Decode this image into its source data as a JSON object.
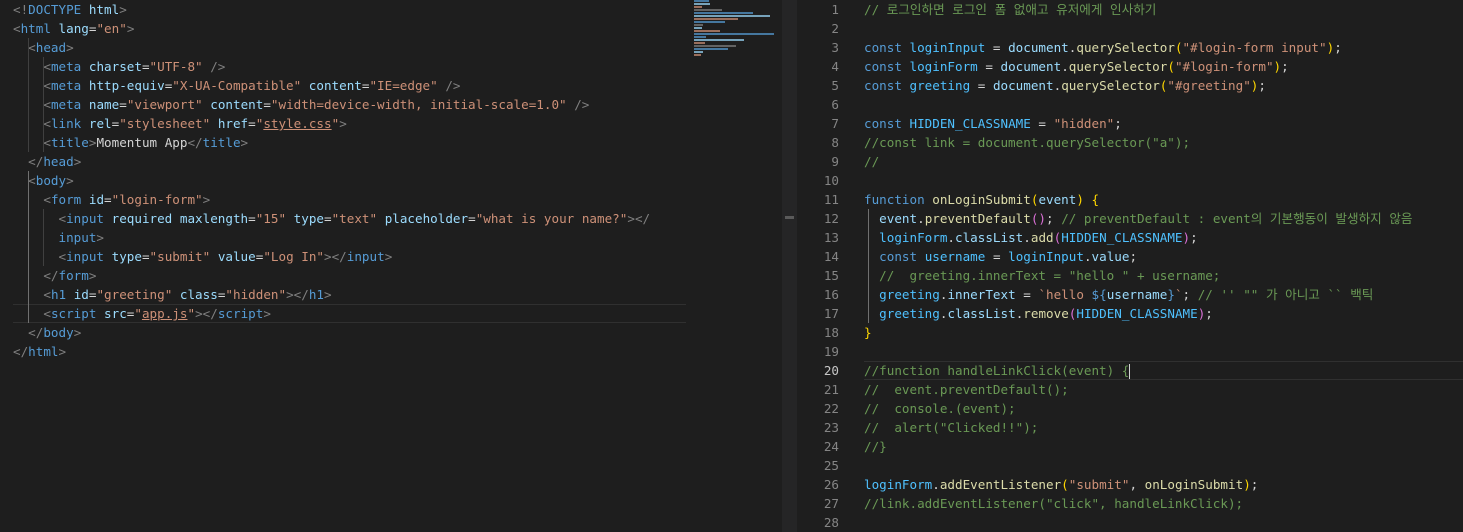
{
  "left_editor": {
    "lines": [
      [
        [
          "t-br",
          "<!"
        ],
        [
          "t-tag",
          "DOCTYPE"
        ],
        [
          "t-p",
          " "
        ],
        [
          "t-attr",
          "html"
        ],
        [
          "t-br",
          ">"
        ]
      ],
      [
        [
          "t-br",
          "<"
        ],
        [
          "t-tag",
          "html"
        ],
        [
          "t-p",
          " "
        ],
        [
          "t-attr",
          "lang"
        ],
        [
          "t-p",
          "="
        ],
        [
          "t-str",
          "\"en\""
        ],
        [
          "t-br",
          ">"
        ]
      ],
      [
        [
          "t-p",
          "  "
        ],
        [
          "t-br",
          "<"
        ],
        [
          "t-tag",
          "head"
        ],
        [
          "t-br",
          ">"
        ]
      ],
      [
        [
          "t-p",
          "    "
        ],
        [
          "t-br",
          "<"
        ],
        [
          "t-tag",
          "meta"
        ],
        [
          "t-p",
          " "
        ],
        [
          "t-attr",
          "charset"
        ],
        [
          "t-p",
          "="
        ],
        [
          "t-str",
          "\"UTF-8\""
        ],
        [
          "t-p",
          " "
        ],
        [
          "t-br",
          "/>"
        ]
      ],
      [
        [
          "t-p",
          "    "
        ],
        [
          "t-br",
          "<"
        ],
        [
          "t-tag",
          "meta"
        ],
        [
          "t-p",
          " "
        ],
        [
          "t-attr",
          "http-equiv"
        ],
        [
          "t-p",
          "="
        ],
        [
          "t-str",
          "\"X-UA-Compatible\""
        ],
        [
          "t-p",
          " "
        ],
        [
          "t-attr",
          "content"
        ],
        [
          "t-p",
          "="
        ],
        [
          "t-str",
          "\"IE=edge\""
        ],
        [
          "t-p",
          " "
        ],
        [
          "t-br",
          "/>"
        ]
      ],
      [
        [
          "t-p",
          "    "
        ],
        [
          "t-br",
          "<"
        ],
        [
          "t-tag",
          "meta"
        ],
        [
          "t-p",
          " "
        ],
        [
          "t-attr",
          "name"
        ],
        [
          "t-p",
          "="
        ],
        [
          "t-str",
          "\"viewport\""
        ],
        [
          "t-p",
          " "
        ],
        [
          "t-attr",
          "content"
        ],
        [
          "t-p",
          "="
        ],
        [
          "t-str",
          "\"width=device-width, initial-scale=1.0\""
        ],
        [
          "t-p",
          " "
        ],
        [
          "t-br",
          "/>"
        ]
      ],
      [
        [
          "t-p",
          "    "
        ],
        [
          "t-br",
          "<"
        ],
        [
          "t-tag",
          "link"
        ],
        [
          "t-p",
          " "
        ],
        [
          "t-attr",
          "rel"
        ],
        [
          "t-p",
          "="
        ],
        [
          "t-str",
          "\"stylesheet\""
        ],
        [
          "t-p",
          " "
        ],
        [
          "t-attr",
          "href"
        ],
        [
          "t-p",
          "="
        ],
        [
          "t-str",
          "\""
        ],
        [
          "t-link",
          "style.css"
        ],
        [
          "t-str",
          "\""
        ],
        [
          "t-br",
          ">"
        ]
      ],
      [
        [
          "t-p",
          "    "
        ],
        [
          "t-br",
          "<"
        ],
        [
          "t-tag",
          "title"
        ],
        [
          "t-br",
          ">"
        ],
        [
          "t-text",
          "Momentum App"
        ],
        [
          "t-br",
          "</"
        ],
        [
          "t-tag",
          "title"
        ],
        [
          "t-br",
          ">"
        ]
      ],
      [
        [
          "t-p",
          "  "
        ],
        [
          "t-br",
          "</"
        ],
        [
          "t-tag",
          "head"
        ],
        [
          "t-br",
          ">"
        ]
      ],
      [
        [
          "t-p",
          "  "
        ],
        [
          "t-br",
          "<"
        ],
        [
          "t-tag",
          "body"
        ],
        [
          "t-br",
          ">"
        ]
      ],
      [
        [
          "t-p",
          "    "
        ],
        [
          "t-br",
          "<"
        ],
        [
          "t-tag",
          "form"
        ],
        [
          "t-p",
          " "
        ],
        [
          "t-attr",
          "id"
        ],
        [
          "t-p",
          "="
        ],
        [
          "t-str",
          "\"login-form\""
        ],
        [
          "t-br",
          ">"
        ]
      ],
      [
        [
          "t-p",
          "      "
        ],
        [
          "t-br",
          "<"
        ],
        [
          "t-tag",
          "input"
        ],
        [
          "t-p",
          " "
        ],
        [
          "t-attr",
          "required"
        ],
        [
          "t-p",
          " "
        ],
        [
          "t-attr",
          "maxlength"
        ],
        [
          "t-p",
          "="
        ],
        [
          "t-str",
          "\"15\""
        ],
        [
          "t-p",
          " "
        ],
        [
          "t-attr",
          "type"
        ],
        [
          "t-p",
          "="
        ],
        [
          "t-str",
          "\"text\""
        ],
        [
          "t-p",
          " "
        ],
        [
          "t-attr",
          "placeholder"
        ],
        [
          "t-p",
          "="
        ],
        [
          "t-str",
          "\"what is your name?\""
        ],
        [
          "t-br",
          ">"
        ],
        [
          "t-br",
          "</"
        ]
      ],
      [
        [
          "t-p",
          "      "
        ],
        [
          "t-tag",
          "input"
        ],
        [
          "t-br",
          ">"
        ]
      ],
      [
        [
          "t-p",
          "      "
        ],
        [
          "t-br",
          "<"
        ],
        [
          "t-tag",
          "input"
        ],
        [
          "t-p",
          " "
        ],
        [
          "t-attr",
          "type"
        ],
        [
          "t-p",
          "="
        ],
        [
          "t-str",
          "\"submit\""
        ],
        [
          "t-p",
          " "
        ],
        [
          "t-attr",
          "value"
        ],
        [
          "t-p",
          "="
        ],
        [
          "t-str",
          "\"Log In\""
        ],
        [
          "t-br",
          ">"
        ],
        [
          "t-br",
          "</"
        ],
        [
          "t-tag",
          "input"
        ],
        [
          "t-br",
          ">"
        ]
      ],
      [
        [
          "t-p",
          "    "
        ],
        [
          "t-br",
          "</"
        ],
        [
          "t-tag",
          "form"
        ],
        [
          "t-br",
          ">"
        ]
      ],
      [
        [
          "t-p",
          "    "
        ],
        [
          "t-br",
          "<"
        ],
        [
          "t-tag",
          "h1"
        ],
        [
          "t-p",
          " "
        ],
        [
          "t-attr",
          "id"
        ],
        [
          "t-p",
          "="
        ],
        [
          "t-str",
          "\"greeting\""
        ],
        [
          "t-p",
          " "
        ],
        [
          "t-attr",
          "class"
        ],
        [
          "t-p",
          "="
        ],
        [
          "t-str",
          "\"hidden\""
        ],
        [
          "t-br",
          ">"
        ],
        [
          "t-br",
          "</"
        ],
        [
          "t-tag",
          "h1"
        ],
        [
          "t-br",
          ">"
        ]
      ],
      [
        [
          "t-p",
          "    "
        ],
        [
          "t-br",
          "<"
        ],
        [
          "t-tag",
          "script"
        ],
        [
          "t-p",
          " "
        ],
        [
          "t-attr",
          "src"
        ],
        [
          "t-p",
          "="
        ],
        [
          "t-str",
          "\""
        ],
        [
          "t-link",
          "app.js"
        ],
        [
          "t-str",
          "\""
        ],
        [
          "t-br",
          ">"
        ],
        [
          "t-br",
          "</"
        ],
        [
          "t-tag",
          "script"
        ],
        [
          "t-br",
          ">"
        ]
      ],
      [
        [
          "t-p",
          "  "
        ],
        [
          "t-br",
          "</"
        ],
        [
          "t-tag",
          "body"
        ],
        [
          "t-br",
          ">"
        ]
      ],
      [
        [
          "t-br",
          "</"
        ],
        [
          "t-tag",
          "html"
        ],
        [
          "t-br",
          ">"
        ]
      ]
    ]
  },
  "right_editor": {
    "current_line": 20,
    "line_numbers": [
      "1",
      "2",
      "3",
      "4",
      "5",
      "6",
      "7",
      "8",
      "9",
      "10",
      "11",
      "12",
      "13",
      "14",
      "15",
      "16",
      "17",
      "18",
      "19",
      "20",
      "21",
      "22",
      "23",
      "24",
      "25",
      "26",
      "27",
      "28"
    ],
    "lines": [
      [
        [
          "t-com",
          "// 로그인하면 로그인 폼 없애고 유저에게 인사하기"
        ]
      ],
      [],
      [
        [
          "t-kw",
          "const"
        ],
        [
          "t-p",
          " "
        ],
        [
          "t-const",
          "loginInput"
        ],
        [
          "t-p",
          " = "
        ],
        [
          "t-var",
          "document"
        ],
        [
          "t-p",
          "."
        ],
        [
          "t-fn",
          "querySelector"
        ],
        [
          "t-y",
          "("
        ],
        [
          "t-str",
          "\"#login-form input\""
        ],
        [
          "t-y",
          ")"
        ],
        [
          "t-p",
          ";"
        ]
      ],
      [
        [
          "t-kw",
          "const"
        ],
        [
          "t-p",
          " "
        ],
        [
          "t-const",
          "loginForm"
        ],
        [
          "t-p",
          " = "
        ],
        [
          "t-var",
          "document"
        ],
        [
          "t-p",
          "."
        ],
        [
          "t-fn",
          "querySelector"
        ],
        [
          "t-y",
          "("
        ],
        [
          "t-str",
          "\"#login-form\""
        ],
        [
          "t-y",
          ")"
        ],
        [
          "t-p",
          ";"
        ]
      ],
      [
        [
          "t-kw",
          "const"
        ],
        [
          "t-p",
          " "
        ],
        [
          "t-const",
          "greeting"
        ],
        [
          "t-p",
          " = "
        ],
        [
          "t-var",
          "document"
        ],
        [
          "t-p",
          "."
        ],
        [
          "t-fn",
          "querySelector"
        ],
        [
          "t-y",
          "("
        ],
        [
          "t-str",
          "\"#greeting\""
        ],
        [
          "t-y",
          ")"
        ],
        [
          "t-p",
          ";"
        ]
      ],
      [],
      [
        [
          "t-kw",
          "const"
        ],
        [
          "t-p",
          " "
        ],
        [
          "t-const",
          "HIDDEN_CLASSNAME"
        ],
        [
          "t-p",
          " = "
        ],
        [
          "t-str",
          "\"hidden\""
        ],
        [
          "t-p",
          ";"
        ]
      ],
      [
        [
          "t-com",
          "//const link = document.querySelector(\"a\");"
        ]
      ],
      [
        [
          "t-com",
          "//"
        ]
      ],
      [],
      [
        [
          "t-kw",
          "function"
        ],
        [
          "t-p",
          " "
        ],
        [
          "t-fn",
          "onLoginSubmit"
        ],
        [
          "t-y",
          "("
        ],
        [
          "t-var",
          "event"
        ],
        [
          "t-y",
          ")"
        ],
        [
          "t-p",
          " "
        ],
        [
          "t-y",
          "{"
        ]
      ],
      [
        [
          "t-p",
          "  "
        ],
        [
          "t-var",
          "event"
        ],
        [
          "t-p",
          "."
        ],
        [
          "t-fn",
          "preventDefault"
        ],
        [
          "t-m",
          "()"
        ],
        [
          "t-p",
          "; "
        ],
        [
          "t-com",
          "// preventDefault : event의 기본행동이 발생하지 않음"
        ]
      ],
      [
        [
          "t-p",
          "  "
        ],
        [
          "t-const",
          "loginForm"
        ],
        [
          "t-p",
          "."
        ],
        [
          "t-var",
          "classList"
        ],
        [
          "t-p",
          "."
        ],
        [
          "t-fn",
          "add"
        ],
        [
          "t-m",
          "("
        ],
        [
          "t-const",
          "HIDDEN_CLASSNAME"
        ],
        [
          "t-m",
          ")"
        ],
        [
          "t-p",
          ";"
        ]
      ],
      [
        [
          "t-p",
          "  "
        ],
        [
          "t-kw",
          "const"
        ],
        [
          "t-p",
          " "
        ],
        [
          "t-const",
          "username"
        ],
        [
          "t-p",
          " = "
        ],
        [
          "t-const",
          "loginInput"
        ],
        [
          "t-p",
          "."
        ],
        [
          "t-var",
          "value"
        ],
        [
          "t-p",
          ";"
        ]
      ],
      [
        [
          "t-p",
          "  "
        ],
        [
          "t-com",
          "//  greeting.innerText = \"hello \" + username;"
        ]
      ],
      [
        [
          "t-p",
          "  "
        ],
        [
          "t-const",
          "greeting"
        ],
        [
          "t-p",
          "."
        ],
        [
          "t-var",
          "innerText"
        ],
        [
          "t-p",
          " = "
        ],
        [
          "t-str",
          "`hello "
        ],
        [
          "t-kw",
          "${"
        ],
        [
          "t-var",
          "username"
        ],
        [
          "t-kw",
          "}"
        ],
        [
          "t-str",
          "`"
        ],
        [
          "t-p",
          "; "
        ],
        [
          "t-com",
          "// '' \"\" 가 아니고 `` 백틱"
        ]
      ],
      [
        [
          "t-p",
          "  "
        ],
        [
          "t-const",
          "greeting"
        ],
        [
          "t-p",
          "."
        ],
        [
          "t-var",
          "classList"
        ],
        [
          "t-p",
          "."
        ],
        [
          "t-fn",
          "remove"
        ],
        [
          "t-m",
          "("
        ],
        [
          "t-const",
          "HIDDEN_CLASSNAME"
        ],
        [
          "t-m",
          ")"
        ],
        [
          "t-p",
          ";"
        ]
      ],
      [
        [
          "t-y",
          "}"
        ]
      ],
      [],
      [
        [
          "t-com",
          "//function handleLinkClick(event) {"
        ]
      ],
      [
        [
          "t-com",
          "//  event.preventDefault();"
        ]
      ],
      [
        [
          "t-com",
          "//  console.(event);"
        ]
      ],
      [
        [
          "t-com",
          "//  alert(\"Clicked!!\");"
        ]
      ],
      [
        [
          "t-com",
          "//}"
        ]
      ],
      [],
      [
        [
          "t-const",
          "loginForm"
        ],
        [
          "t-p",
          "."
        ],
        [
          "t-fn",
          "addEventListener"
        ],
        [
          "t-y",
          "("
        ],
        [
          "t-str",
          "\"submit\""
        ],
        [
          "t-p",
          ", "
        ],
        [
          "t-fn",
          "onLoginSubmit"
        ],
        [
          "t-y",
          ")"
        ],
        [
          "t-p",
          ";"
        ]
      ],
      [
        [
          "t-com",
          "//link.addEventListener(\"click\", handleLinkClick);"
        ]
      ],
      []
    ]
  }
}
